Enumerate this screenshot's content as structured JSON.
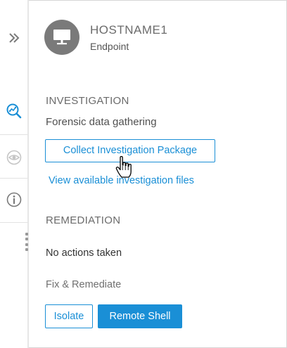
{
  "header": {
    "host_name": "HOSTNAME1",
    "host_type": "Endpoint",
    "avatar_icon": "monitor-icon"
  },
  "rail": {
    "items": [
      {
        "icon": "double-chevron-right-icon",
        "color": "#7a7a7a"
      },
      {
        "icon": "investigation-icon",
        "color": "#1a8fd6",
        "active": true
      },
      {
        "icon": "eye-icon",
        "color": "#c4c4c4"
      },
      {
        "icon": "info-icon",
        "color": "#7a7a7a"
      }
    ]
  },
  "investigation": {
    "title": "INVESTIGATION",
    "subtitle": "Forensic data gathering",
    "collect_button": "Collect Investigation Package",
    "view_link": "View available investigation files"
  },
  "remediation": {
    "title": "REMEDIATION",
    "status": "No actions taken",
    "fix_label": "Fix & Remediate",
    "isolate_button": "Isolate",
    "remote_shell_button": "Remote Shell"
  },
  "colors": {
    "accent": "#1a8fd6",
    "avatar_bg": "#7a7a7a"
  }
}
